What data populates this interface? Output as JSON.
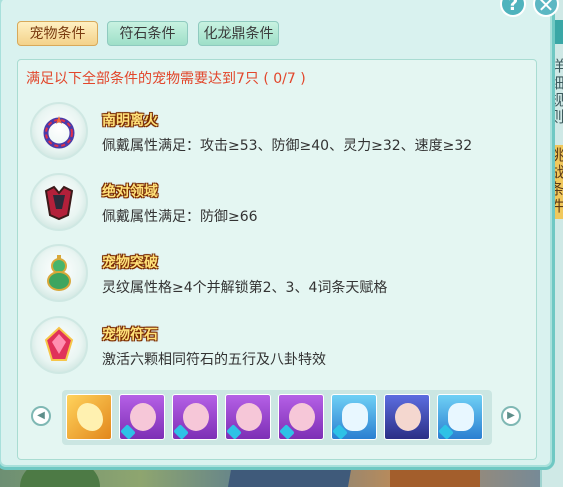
{
  "window": {
    "help_label": "?",
    "close_label": "✕"
  },
  "tabs": [
    {
      "label": "宠物条件",
      "active": true
    },
    {
      "label": "符石条件",
      "active": false
    },
    {
      "label": "化龙鼎条件",
      "active": false
    }
  ],
  "requirement_text": "满足以下全部条件的宠物需要达到7只 ( 0/7 )",
  "conditions": [
    {
      "name": "南明离火",
      "description": "佩戴属性满足：攻击≥53、防御≥40、灵力≥32、速度≥32",
      "icon": "fire-ring-icon"
    },
    {
      "name": "绝对领域",
      "description": "佩戴属性满足：防御≥66",
      "icon": "red-armor-icon"
    },
    {
      "name": "宠物突破",
      "description": "灵纹属性格≥4个并解锁第2、3、4词条天赋格",
      "icon": "jade-gourd-icon"
    },
    {
      "name": "宠物符石",
      "description": "激活六颗相同符石的五行及八卦特效",
      "icon": "rune-crystal-icon"
    }
  ],
  "pets": [
    {
      "type": "dragon",
      "icon": "golden-dragon-pet-icon"
    },
    {
      "type": "girl",
      "icon": "purple-hair-pet-icon"
    },
    {
      "type": "girl",
      "icon": "purple-hair-pet-icon"
    },
    {
      "type": "girl",
      "icon": "purple-hair-pet-icon"
    },
    {
      "type": "girl",
      "icon": "purple-hair-pet-icon"
    },
    {
      "type": "blue",
      "icon": "blue-dragon-pet-icon"
    },
    {
      "type": "maid",
      "icon": "blue-hair-pet-icon"
    },
    {
      "type": "blue",
      "icon": "blue-dragon-pet-icon"
    }
  ],
  "side_panel": {
    "tab1": "详细规则",
    "tab2": "挑战条件"
  },
  "colors": {
    "requirement": "#e2462b",
    "active_tab": "#f3d28a",
    "panel": "#e4f6f2"
  }
}
